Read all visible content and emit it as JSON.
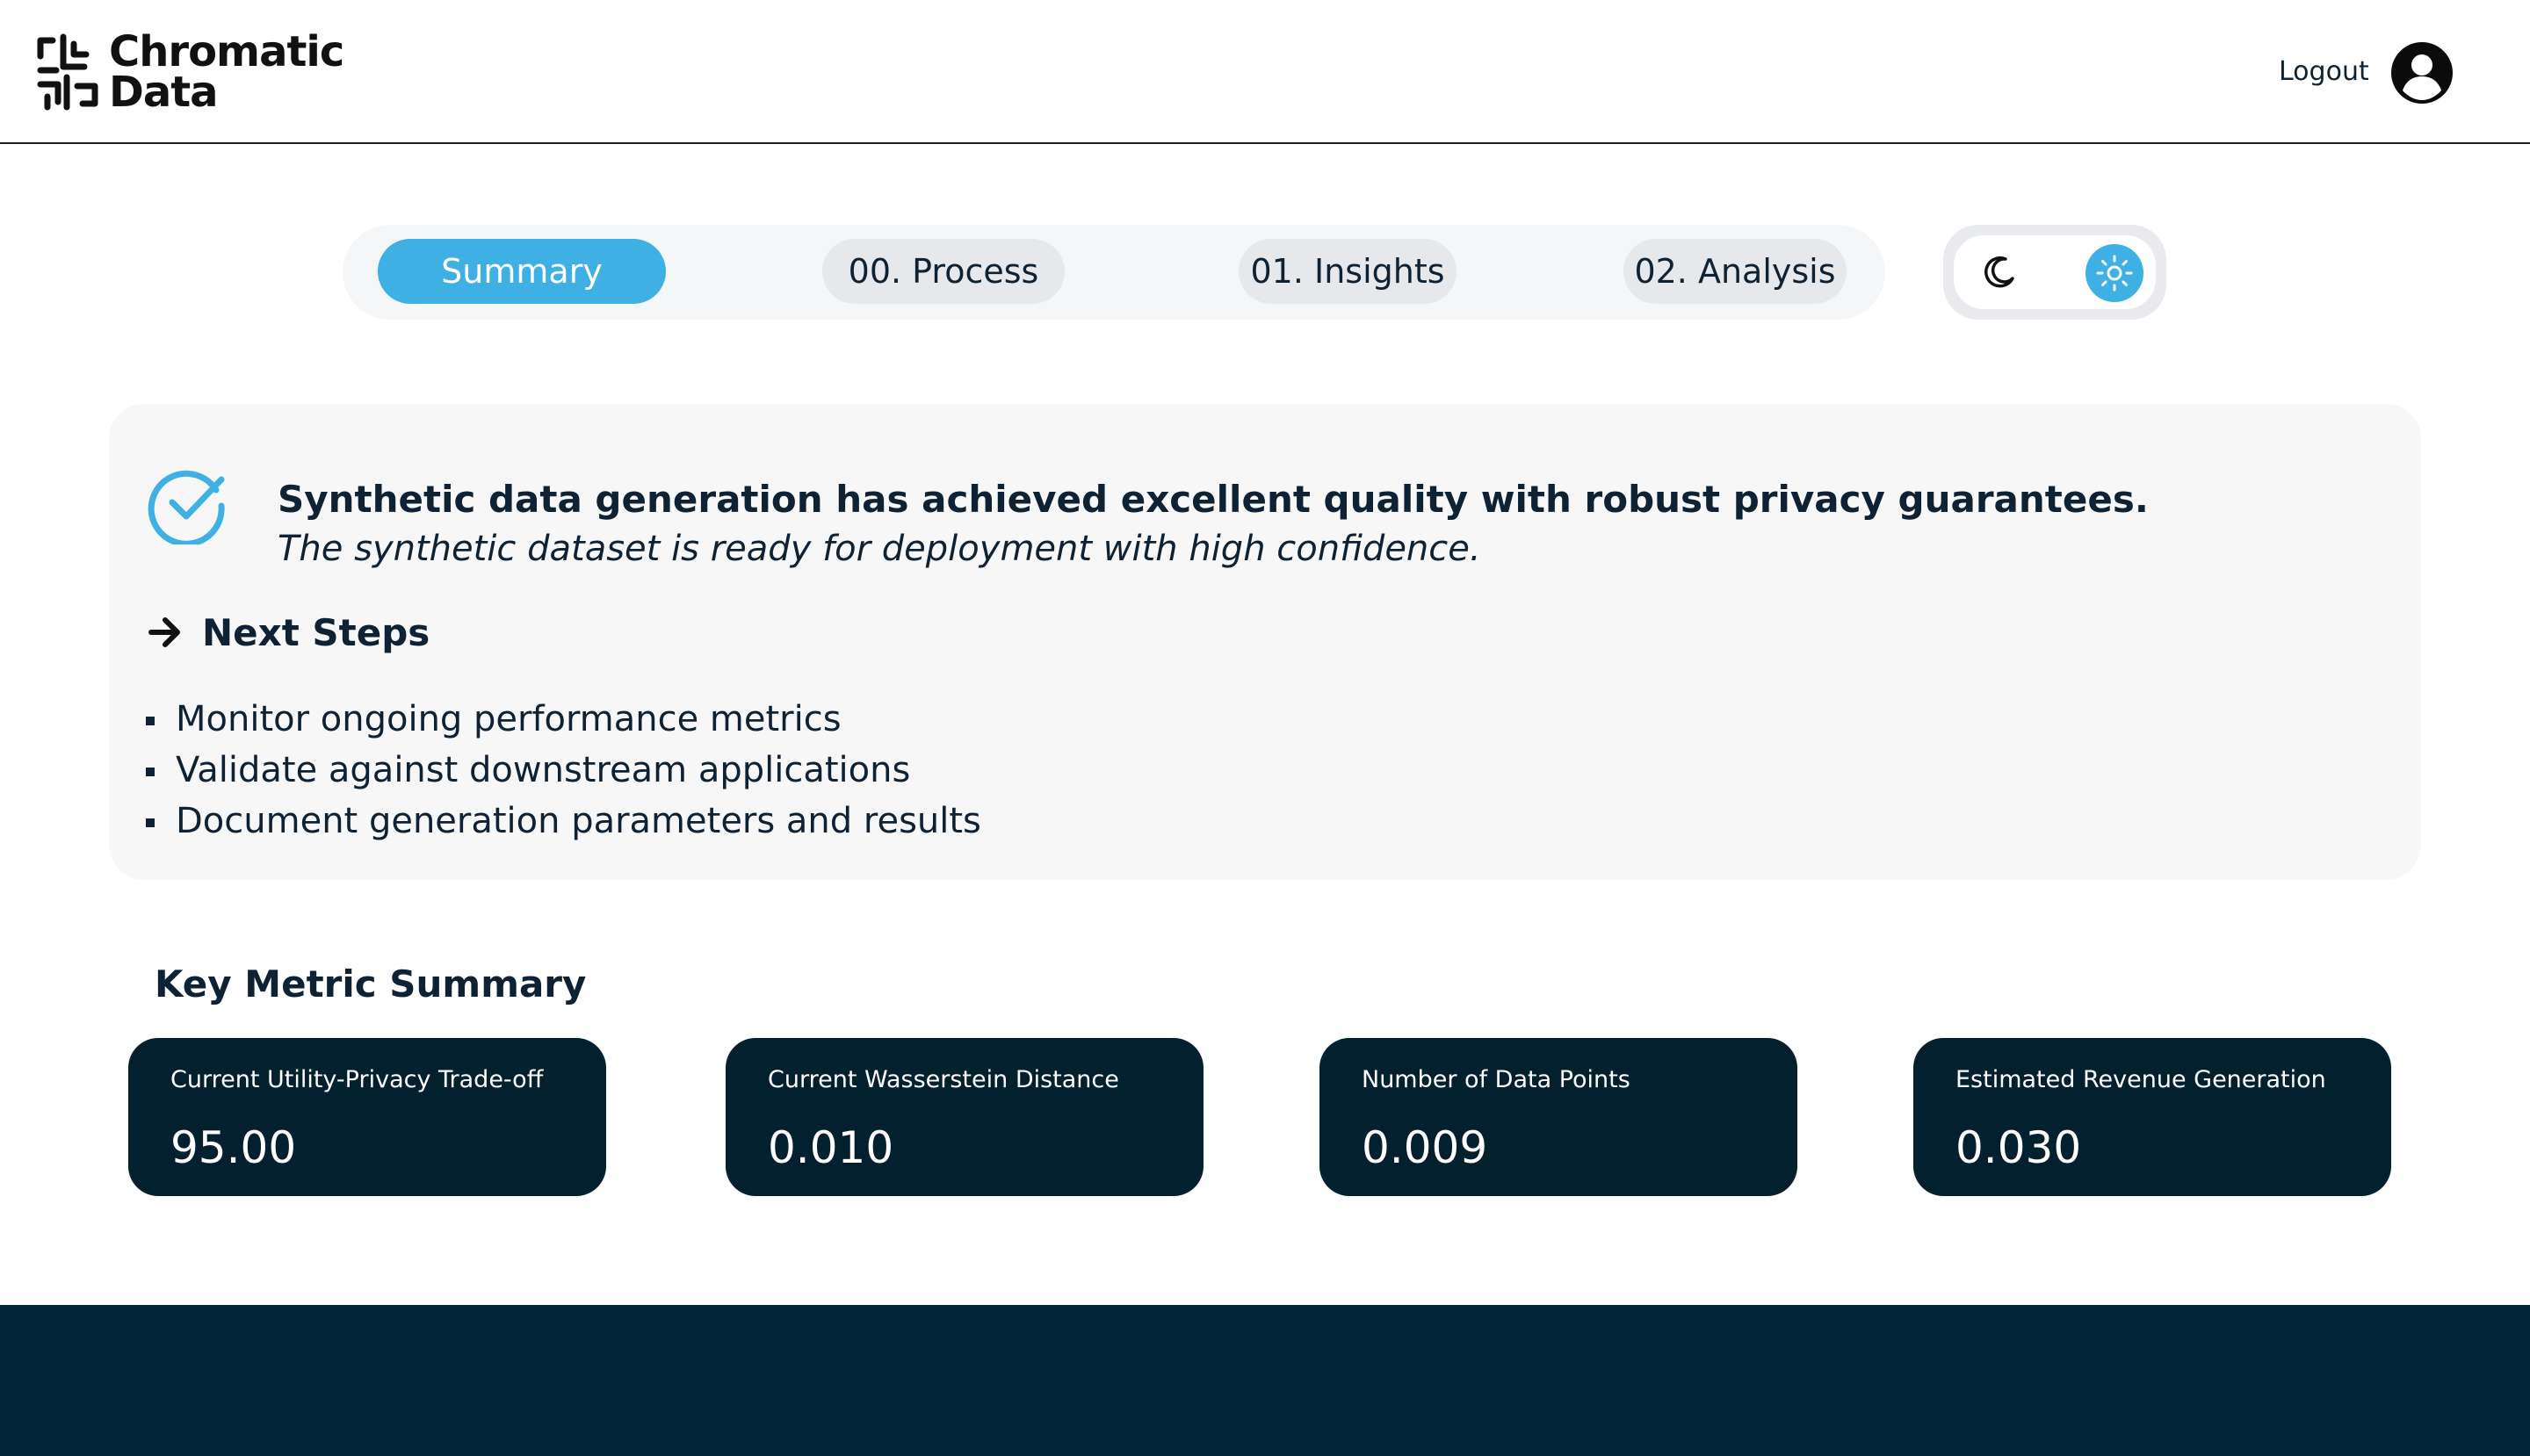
{
  "header": {
    "brand": {
      "line1": "Chromatic",
      "line2": "Data"
    },
    "logout_label": "Logout"
  },
  "tabs": [
    {
      "label": "Summary",
      "active": true
    },
    {
      "label": "00. Process",
      "active": false
    },
    {
      "label": "01. Insights",
      "active": false
    },
    {
      "label": "02. Analysis",
      "active": false
    }
  ],
  "theme": {
    "mode": "light",
    "icons": [
      "moon-icon",
      "sun-icon"
    ]
  },
  "summary": {
    "headline": "Synthetic data generation has achieved excellent quality with robust privacy guarantees.",
    "subline": "The synthetic dataset is ready for deployment with high confidence.",
    "next_steps_title": "Next Steps",
    "steps": [
      "Monitor ongoing performance metrics",
      "Validate against downstream applications",
      "Document generation parameters and results"
    ]
  },
  "metrics": {
    "title": "Key Metric Summary",
    "cards": [
      {
        "label": "Current Utility-Privacy Trade-off",
        "value": "95.00"
      },
      {
        "label": "Current Wasserstein Distance",
        "value": "0.010"
      },
      {
        "label": "Number of Data Points",
        "value": "0.009"
      },
      {
        "label": "Estimated Revenue Generation",
        "value": "0.030"
      }
    ]
  },
  "colors": {
    "accent": "#3eb0e3",
    "dark_navy": "#03202f",
    "footer": "#03253a",
    "tab_inactive": "#e6e8ec",
    "card_bg": "#f7f7f7"
  }
}
